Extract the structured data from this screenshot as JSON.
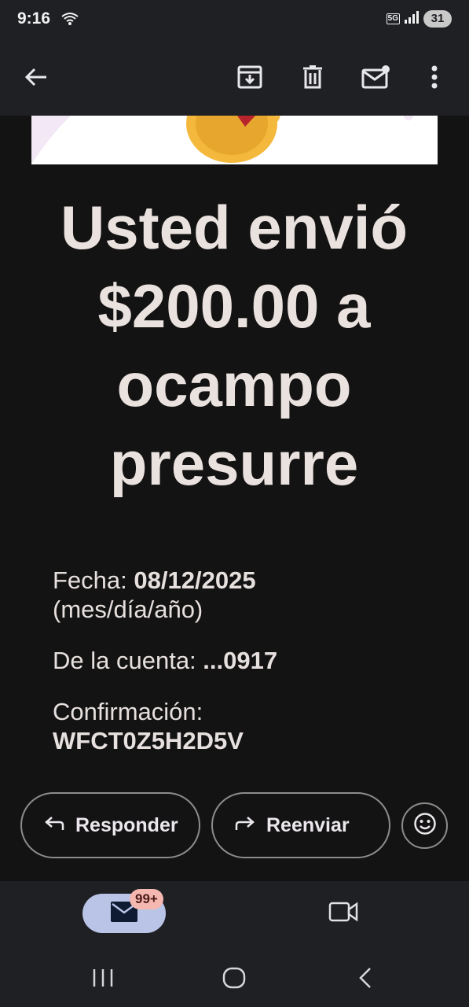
{
  "status_bar": {
    "time": "9:16",
    "network": "5G",
    "battery": "31"
  },
  "app_bar": {
    "icons": [
      "back-arrow-icon",
      "archive-icon",
      "delete-icon",
      "mark-unread-icon",
      "more-vert-icon"
    ]
  },
  "email": {
    "headline": "Usted envió $200.00 a ocampo presurre",
    "date_label": "Fecha:",
    "date_value": "08/12/2025",
    "date_format": "(mes/día/año)",
    "account_label": "De la cuenta:",
    "account_value": "...0917",
    "confirmation_label": "Confirmación:",
    "confirmation_value": "WFCT0Z5H2D5V"
  },
  "actions": {
    "reply_label": "Responder",
    "forward_label": "Reenviar"
  },
  "bottom_nav": {
    "mail_badge": "99+"
  },
  "colors": {
    "background": "#1f2024",
    "card": "#141313",
    "text": "#eae2df",
    "tab_active": "#b9c4e6",
    "badge": "#f4b8b1"
  }
}
